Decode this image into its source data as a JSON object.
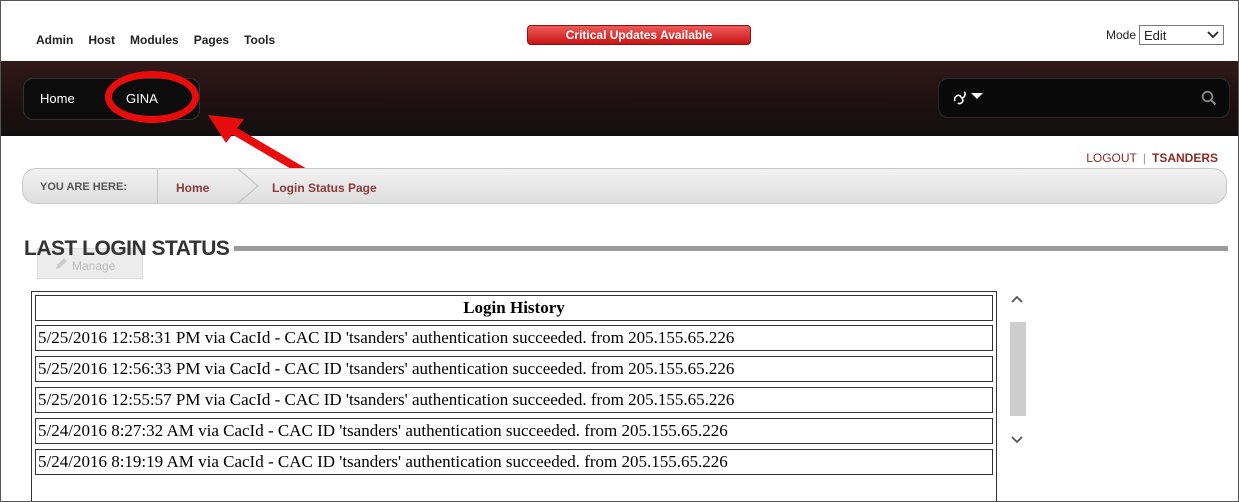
{
  "admin_menu": [
    "Admin",
    "Host",
    "Modules",
    "Pages",
    "Tools"
  ],
  "critical_updates": "Critical Updates Available",
  "mode": {
    "label": "Mode",
    "value": "Edit"
  },
  "nav": {
    "items": [
      "Home",
      "GINA"
    ]
  },
  "user": {
    "logout": "LOGOUT",
    "separator": "|",
    "username": "TSANDERS"
  },
  "breadcrumb": {
    "prefix": "YOU ARE HERE:",
    "home": "Home",
    "current": "Login Status Page"
  },
  "section": {
    "title": "LAST LOGIN STATUS",
    "manage": "Manage"
  },
  "table": {
    "header": "Login History",
    "rows": [
      "5/25/2016 12:58:31 PM via CacId - CAC ID 'tsanders' authentication succeeded. from 205.155.65.226",
      "5/25/2016 12:56:33 PM via CacId - CAC ID 'tsanders' authentication succeeded. from 205.155.65.226",
      "5/25/2016 12:55:57 PM via CacId - CAC ID 'tsanders' authentication succeeded. from 205.155.65.226",
      "5/24/2016 8:27:32 AM via CacId - CAC ID 'tsanders' authentication succeeded. from 205.155.65.226",
      "5/24/2016 8:19:19 AM via CacId - CAC ID 'tsanders' authentication succeeded. from 205.155.65.226"
    ]
  },
  "colors": {
    "highlight": "#e80c0c",
    "link": "#8a3a3a",
    "critical": "#c81414"
  }
}
